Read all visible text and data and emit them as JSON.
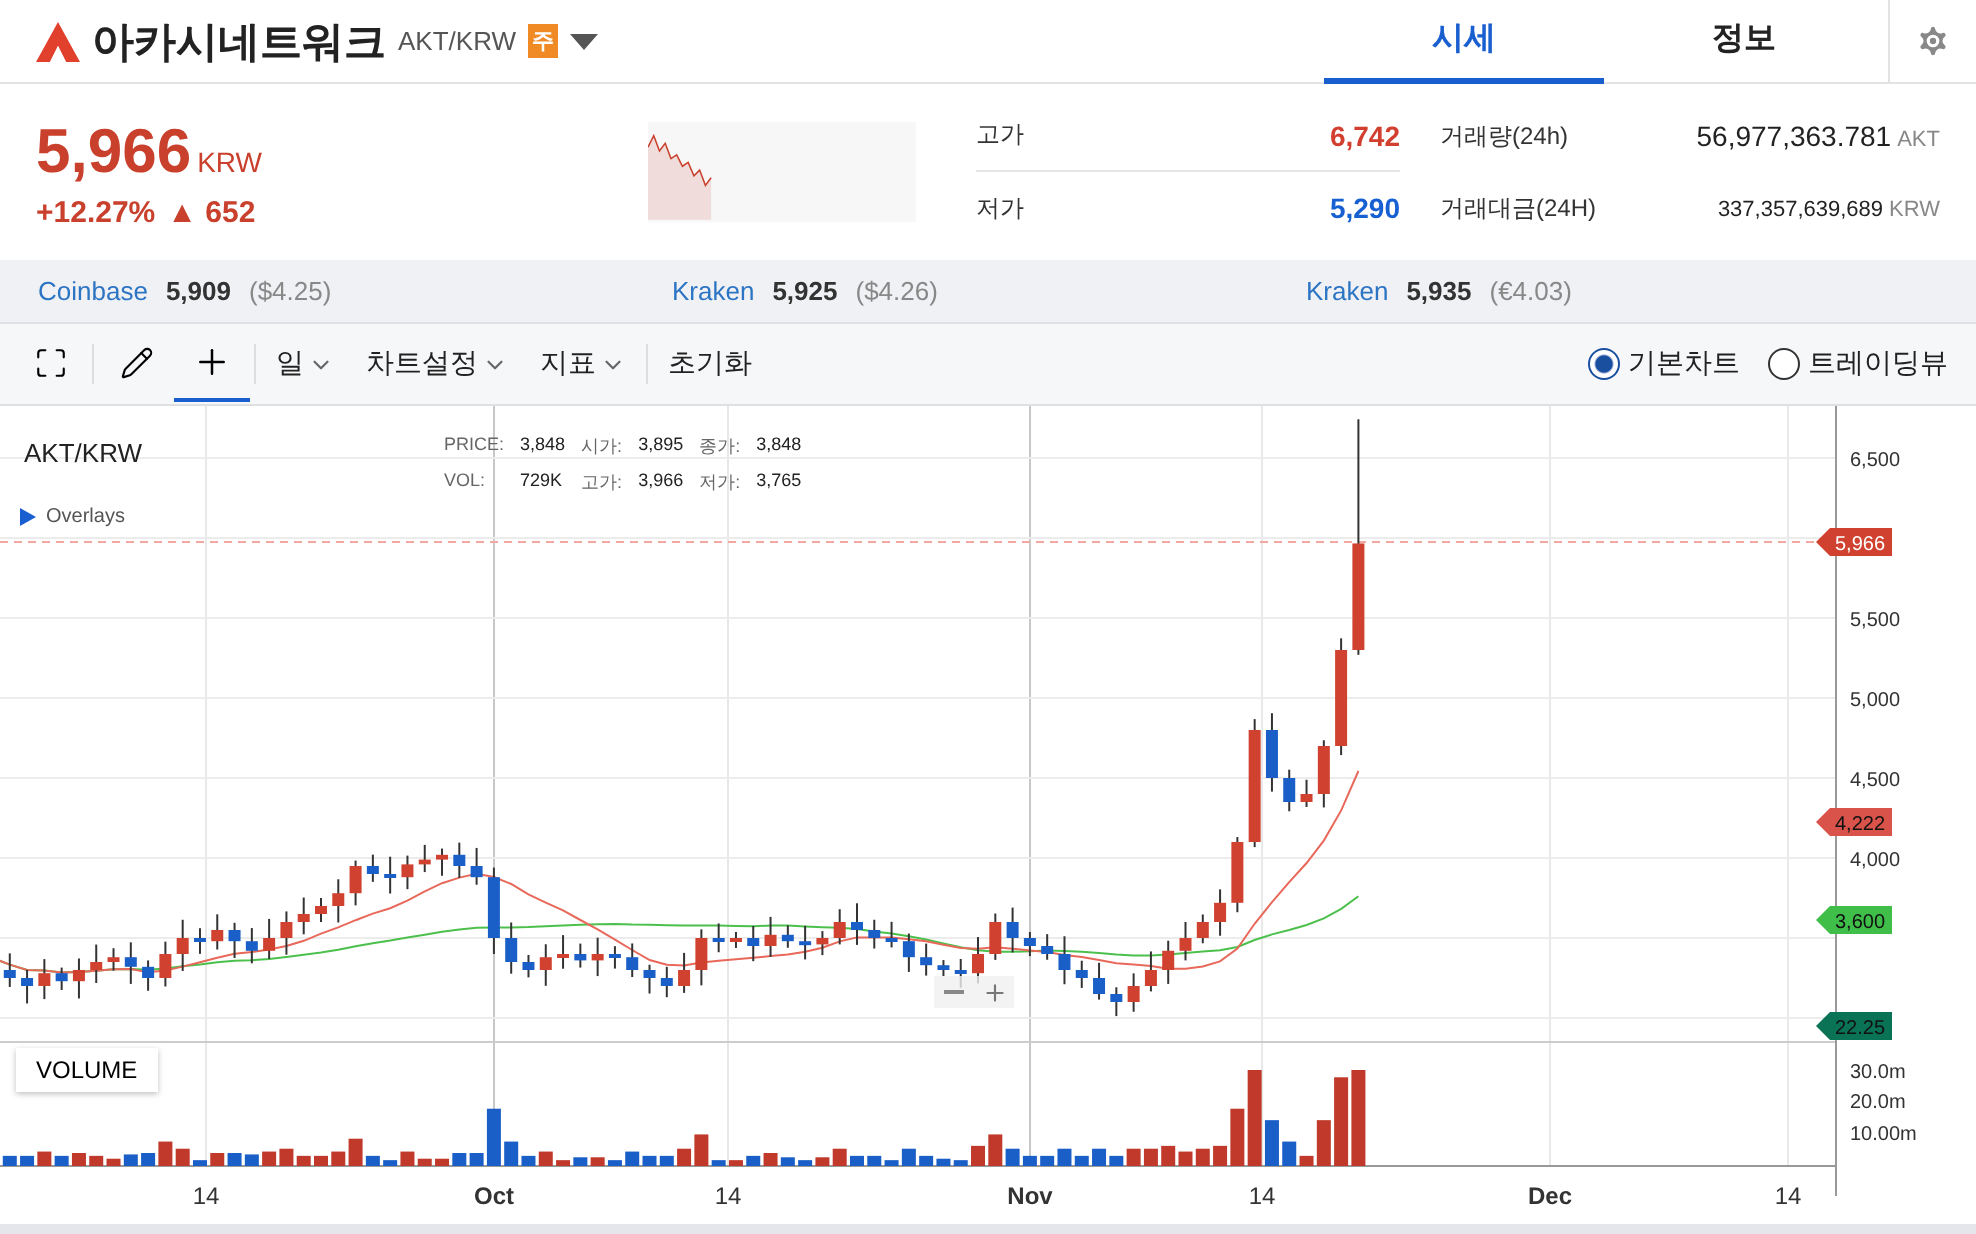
{
  "header": {
    "title": "아카시네트워크",
    "pair": "AKT/KRW",
    "badge": "주",
    "tabs": [
      {
        "label": "시세",
        "selected": true
      },
      {
        "label": "정보",
        "selected": false
      }
    ]
  },
  "price": {
    "value": "5,966",
    "unit": "KRW",
    "change_rate": "+12.27%",
    "arrow": "▲",
    "change": "652"
  },
  "stats": [
    {
      "label": "고가",
      "value": "6,742",
      "color": "#d23f2f"
    },
    {
      "label": "저가",
      "value": "5,290",
      "color": "#1760d2"
    }
  ],
  "volumes": [
    {
      "label": "거래량(24h)",
      "value": "56,977,363.781",
      "unit": "AKT"
    },
    {
      "label": "거래대금(24H)",
      "value": "337,357,639,689",
      "unit": "KRW"
    }
  ],
  "exchanges": [
    {
      "name": "Coinbase",
      "price": "5,909",
      "fiat": "($4.25)"
    },
    {
      "name": "Kraken",
      "price": "5,925",
      "fiat": "($4.26)"
    },
    {
      "name": "Kraken",
      "price": "5,935",
      "fiat": "(€4.03)"
    }
  ],
  "toolbar": {
    "tools": [
      {
        "kind": "fullscreen",
        "selected": false
      },
      {
        "kind": "pencil",
        "selected": false
      },
      {
        "kind": "crosshair",
        "selected": true
      }
    ],
    "menus": [
      "일",
      "차트설정",
      "지표"
    ],
    "reset": "초기화",
    "views": [
      {
        "label": "기본차트",
        "selected": true
      },
      {
        "label": "트레이딩뷰",
        "selected": false
      }
    ]
  },
  "chart": {
    "title": "AKT/KRW",
    "legend": [
      {
        "label": "PRICE:",
        "value": "3,848"
      },
      {
        "label": "시가:",
        "value": "3,895"
      },
      {
        "label": "종가:",
        "value": "3,848"
      },
      {
        "label": "VOL:",
        "value": "729K"
      },
      {
        "label": "고가:",
        "value": "3,966"
      },
      {
        "label": "저가:",
        "value": "3,765"
      }
    ],
    "overlays": "Overlays",
    "volume_label": "VOLUME",
    "y_ticks": [
      "6,500",
      "5,500",
      "5,000",
      "4,500",
      "4,000"
    ],
    "tags": [
      {
        "label": "5,966",
        "color": "#d0412f"
      },
      {
        "label": "4,222",
        "color": "#d9534a"
      },
      {
        "label": "3,600",
        "color": "#3fbf4a"
      },
      {
        "label": "22.25",
        "color": "#0b7355"
      }
    ],
    "volume_ticks": [
      "30.0m",
      "20.0m",
      "10.00m"
    ],
    "x_ticks": [
      "14",
      "Oct",
      "14",
      "Nov",
      "14",
      "Dec",
      "14"
    ]
  }
}
